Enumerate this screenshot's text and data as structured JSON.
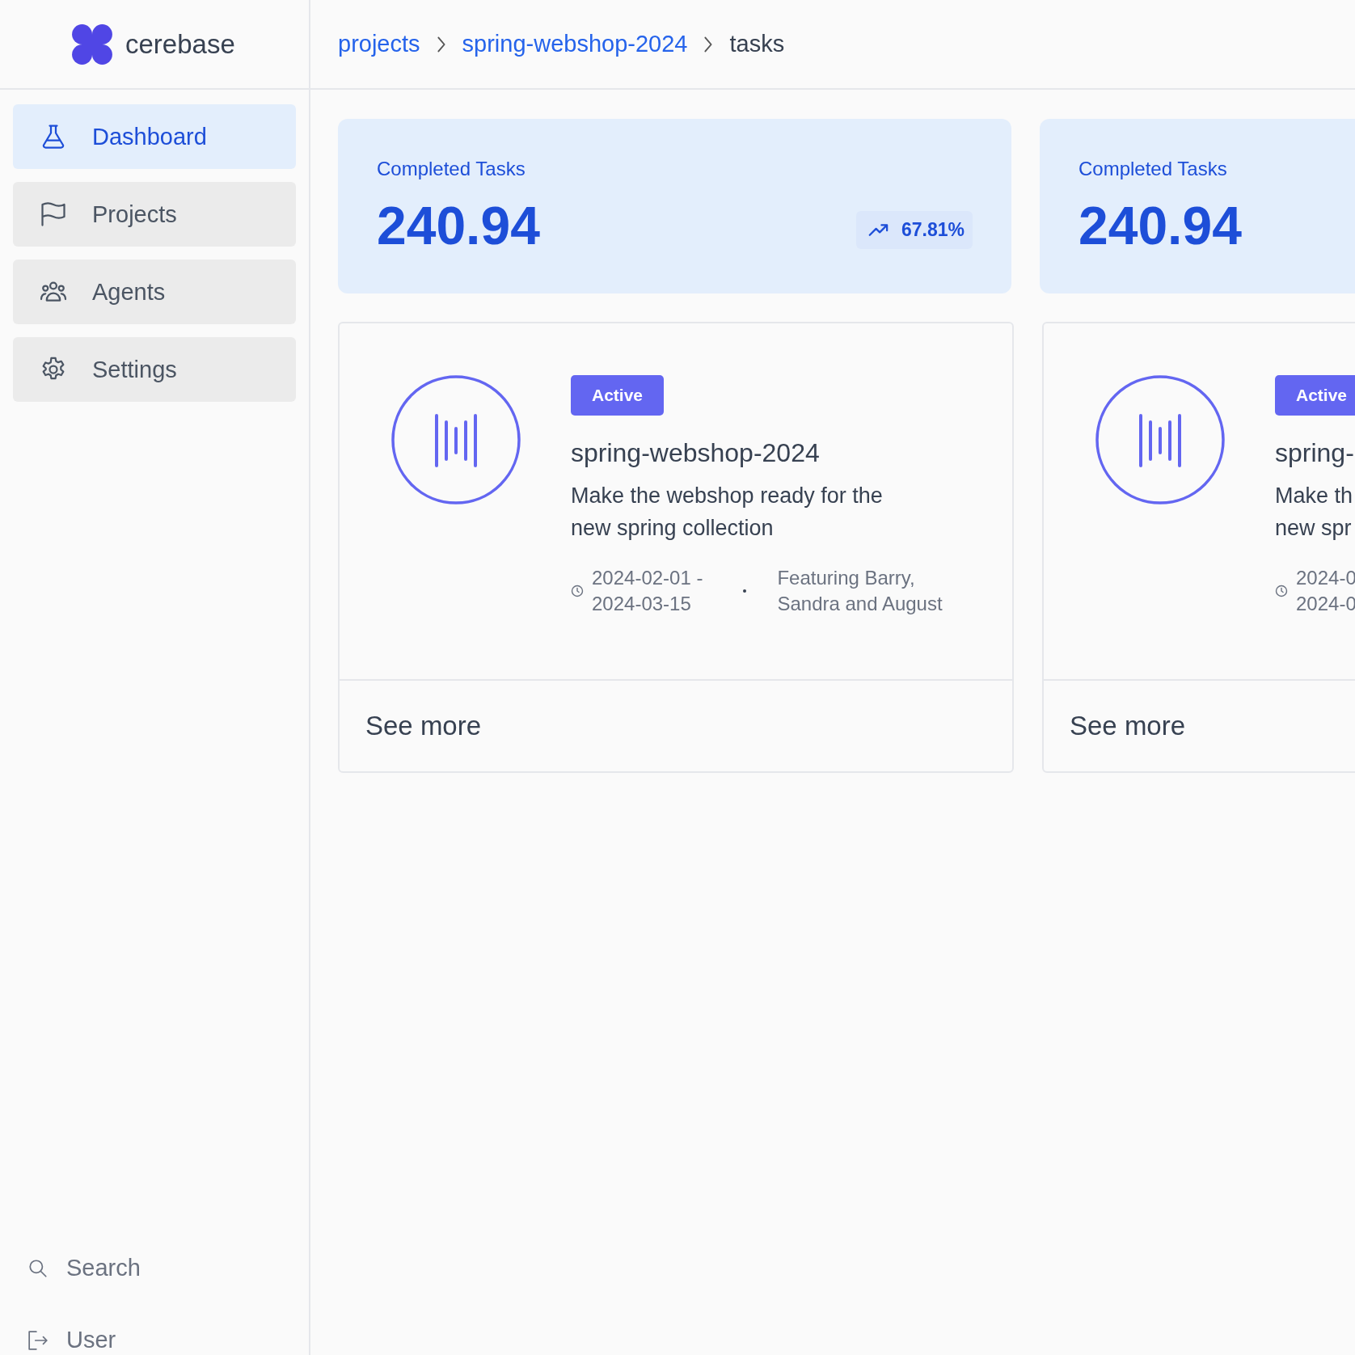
{
  "brand": {
    "name": "cerebase"
  },
  "breadcrumb": [
    {
      "label": "projects",
      "link": true
    },
    {
      "label": "spring-webshop-2024",
      "link": true
    },
    {
      "label": "tasks",
      "link": false
    }
  ],
  "sidebar": {
    "items": [
      {
        "label": "Dashboard",
        "selected": true
      },
      {
        "label": "Projects",
        "selected": false
      },
      {
        "label": "Agents",
        "selected": false
      },
      {
        "label": "Settings",
        "selected": false
      }
    ],
    "footer": [
      {
        "label": "Search"
      },
      {
        "label": "User"
      }
    ]
  },
  "stats": [
    {
      "label": "Completed Tasks",
      "value": "240.94",
      "trend": "67.81%"
    },
    {
      "label": "Completed Tasks",
      "value": "240.94"
    }
  ],
  "projects": [
    {
      "status": "Active",
      "title": "spring-webshop-2024",
      "description_lines": [
        "Make the webshop ready for the",
        "new spring collection"
      ],
      "date_lines": [
        "2024-02-01 -",
        "2024-03-15"
      ],
      "people_lines": [
        "Featuring Barry,",
        "Sandra and August"
      ],
      "link": "See more"
    },
    {
      "status": "Active",
      "title": "spring-",
      "description_lines": [
        "Make th",
        "new spr"
      ],
      "date_lines": [
        "2024-0",
        "2024-0"
      ],
      "link": "See more"
    }
  ]
}
